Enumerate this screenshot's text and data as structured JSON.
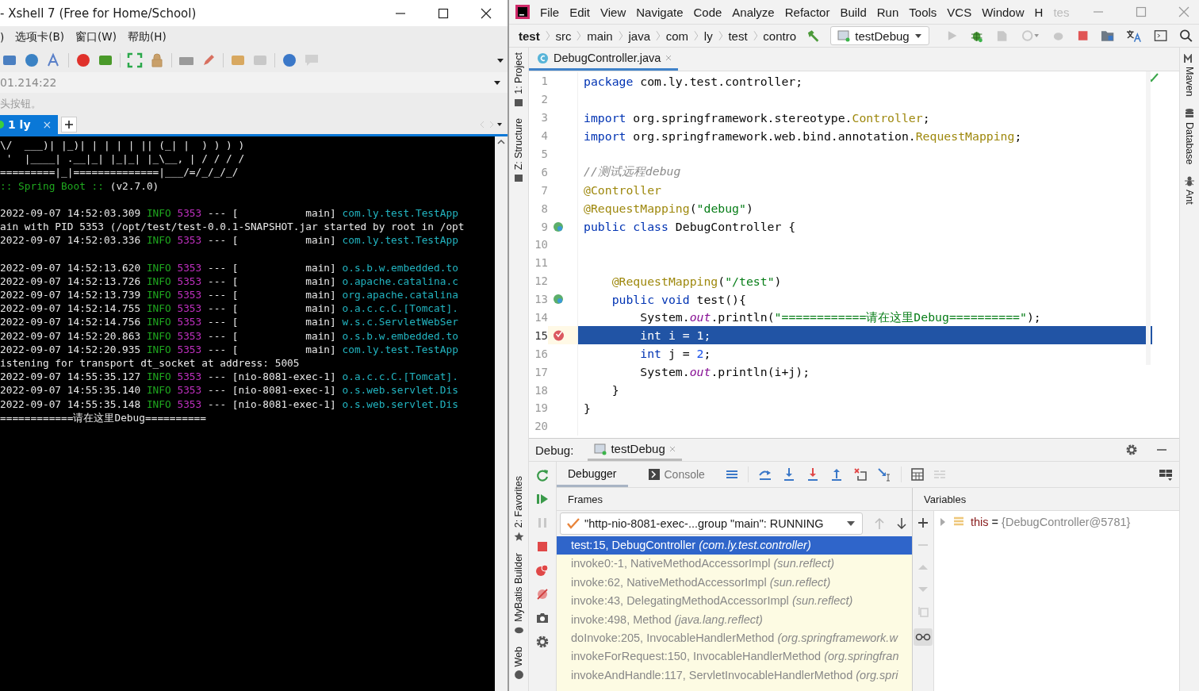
{
  "xshell": {
    "title": "- Xshell 7 (Free for Home/School)",
    "menu": [
      ")",
      "选项卡(B)",
      "窗口(W)",
      "帮助(H)"
    ],
    "address": "01.214:22",
    "hint": "头按钮。",
    "tabs": [
      {
        "label": "1 ly",
        "close": "×",
        "selected": true
      }
    ],
    "terminal": [
      {
        "kind": "art",
        "text": "\\/  ___)| |_)| | | | | || (_| |  ) ) ) )"
      },
      {
        "kind": "art",
        "text": " '  |____| .__|_| |_|_| |_\\__, | / / / /"
      },
      {
        "kind": "art",
        "text": "=========|_|==============|___/=/_/_/_/"
      },
      {
        "kind": "banner",
        "label": ":: Spring Boot ::",
        "version": "(v2.7.0)"
      },
      {
        "kind": "blank"
      },
      {
        "kind": "log",
        "time": "2022-09-07 14:52:03.309",
        "level": "INFO",
        "pid": "5353",
        "thread": "--- [           main]",
        "logger": "com.ly.test.TestApp"
      },
      {
        "kind": "text",
        "text": "ain with PID 5353 (/opt/test/test-0.0.1-SNAPSHOT.jar started by root in /opt"
      },
      {
        "kind": "log",
        "time": "2022-09-07 14:52:03.336",
        "level": "INFO",
        "pid": "5353",
        "thread": "--- [           main]",
        "logger": "com.ly.test.TestApp"
      },
      {
        "kind": "blank"
      },
      {
        "kind": "log",
        "time": "2022-09-07 14:52:13.620",
        "level": "INFO",
        "pid": "5353",
        "thread": "--- [           main]",
        "logger": "o.s.b.w.embedded.to"
      },
      {
        "kind": "log",
        "time": "2022-09-07 14:52:13.726",
        "level": "INFO",
        "pid": "5353",
        "thread": "--- [           main]",
        "logger": "o.apache.catalina.c"
      },
      {
        "kind": "log",
        "time": "2022-09-07 14:52:13.739",
        "level": "INFO",
        "pid": "5353",
        "thread": "--- [           main]",
        "logger": "org.apache.catalina"
      },
      {
        "kind": "log",
        "time": "2022-09-07 14:52:14.755",
        "level": "INFO",
        "pid": "5353",
        "thread": "--- [           main]",
        "logger": "o.a.c.c.C.[Tomcat]."
      },
      {
        "kind": "log",
        "time": "2022-09-07 14:52:14.756",
        "level": "INFO",
        "pid": "5353",
        "thread": "--- [           main]",
        "logger": "w.s.c.ServletWebSer"
      },
      {
        "kind": "log",
        "time": "2022-09-07 14:52:20.863",
        "level": "INFO",
        "pid": "5353",
        "thread": "--- [           main]",
        "logger": "o.s.b.w.embedded.to"
      },
      {
        "kind": "log",
        "time": "2022-09-07 14:52:20.935",
        "level": "INFO",
        "pid": "5353",
        "thread": "--- [           main]",
        "logger": "com.ly.test.TestApp"
      },
      {
        "kind": "text",
        "text": "istening for transport dt_socket at address: 5005"
      },
      {
        "kind": "log",
        "time": "2022-09-07 14:55:35.127",
        "level": "INFO",
        "pid": "5353",
        "thread": "--- [nio-8081-exec-1]",
        "logger": "o.a.c.c.C.[Tomcat]."
      },
      {
        "kind": "log",
        "time": "2022-09-07 14:55:35.140",
        "level": "INFO",
        "pid": "5353",
        "thread": "--- [nio-8081-exec-1]",
        "logger": "o.s.web.servlet.Dis"
      },
      {
        "kind": "log",
        "time": "2022-09-07 14:55:35.148",
        "level": "INFO",
        "pid": "5353",
        "thread": "--- [nio-8081-exec-1]",
        "logger": "o.s.web.servlet.Dis"
      },
      {
        "kind": "text",
        "text": "============请在这里Debug=========="
      }
    ]
  },
  "ide": {
    "menu": [
      "File",
      "Edit",
      "View",
      "Navigate",
      "Code",
      "Analyze",
      "Refactor",
      "Build",
      "Run",
      "Tools",
      "VCS",
      "Window",
      "H"
    ],
    "title": "tes",
    "breadcrumbs": [
      "test",
      "src",
      "main",
      "java",
      "com",
      "ly",
      "test",
      "contro"
    ],
    "run_config": "testDebug",
    "left_tools": [
      "1: Project",
      "Z: Structure"
    ],
    "bottom_tools": [
      "2: Favorites",
      "MyBatis Builder",
      "Web"
    ],
    "right_tools": [
      "Maven",
      "Database",
      "Ant"
    ],
    "editor_tab": "DebugController.java",
    "code": [
      {
        "number": "1",
        "selected": false,
        "tokens": [
          {
            "kind": "kw",
            "text": "package"
          },
          {
            "kind": "plain",
            "text": " com.ly.test.controller;"
          }
        ]
      },
      {
        "number": "2",
        "selected": false
      },
      {
        "number": "3",
        "selected": false,
        "tokens": [
          {
            "kind": "kw",
            "text": "import"
          },
          {
            "kind": "plain",
            "text": " org.springframework.stereotype."
          },
          {
            "kind": "ann",
            "text": "Controller"
          },
          {
            "kind": "plain",
            "text": ";"
          }
        ]
      },
      {
        "number": "4",
        "selected": false,
        "tokens": [
          {
            "kind": "kw",
            "text": "import"
          },
          {
            "kind": "plain",
            "text": " org.springframework.web.bind.annotation."
          },
          {
            "kind": "ann",
            "text": "RequestMapping"
          },
          {
            "kind": "plain",
            "text": ";"
          }
        ]
      },
      {
        "number": "5",
        "selected": false
      },
      {
        "number": "6",
        "selected": false,
        "tokens": [
          {
            "kind": "com",
            "text": "//测试远程debug"
          }
        ]
      },
      {
        "number": "7",
        "selected": false,
        "tokens": [
          {
            "kind": "ann",
            "text": "@Controller"
          }
        ]
      },
      {
        "number": "8",
        "selected": false,
        "tokens": [
          {
            "kind": "ann",
            "text": "@RequestMapping"
          },
          {
            "kind": "plain",
            "text": "("
          },
          {
            "kind": "str",
            "text": "\"debug\""
          },
          {
            "kind": "plain",
            "text": ")"
          }
        ]
      },
      {
        "number": "9",
        "selected": false,
        "kind": "bean",
        "tokens": [
          {
            "kind": "kw",
            "text": "public class"
          },
          {
            "kind": "plain",
            "text": " DebugController {"
          }
        ]
      },
      {
        "number": "10",
        "selected": false
      },
      {
        "number": "11",
        "selected": false
      },
      {
        "number": "12",
        "selected": false,
        "tokens": [
          {
            "kind": "ann",
            "text": "    @RequestMapping"
          },
          {
            "kind": "plain",
            "text": "("
          },
          {
            "kind": "str",
            "text": "\"/test\""
          },
          {
            "kind": "plain",
            "text": ")"
          }
        ]
      },
      {
        "number": "13",
        "selected": false,
        "kind": "bean",
        "tokens": [
          {
            "kind": "kw",
            "text": "    public void"
          },
          {
            "kind": "plain",
            "text": " test(){"
          }
        ]
      },
      {
        "number": "14",
        "selected": false,
        "tokens": [
          {
            "kind": "plain",
            "text": "        System."
          },
          {
            "kind": "field",
            "text": "out"
          },
          {
            "kind": "plain",
            "text": ".println("
          },
          {
            "kind": "str",
            "text": "\"============请在这里Debug==========\""
          },
          {
            "kind": "plain",
            "text": ");"
          }
        ]
      },
      {
        "number": "15",
        "selected": true,
        "kind": "breakpoint",
        "tokens": [
          {
            "kind": "kw",
            "text": "        int"
          },
          {
            "kind": "plain",
            "text": " i = "
          },
          {
            "kind": "num",
            "text": "1"
          },
          {
            "kind": "plain",
            "text": ";"
          }
        ]
      },
      {
        "number": "16",
        "selected": false,
        "tokens": [
          {
            "kind": "kw",
            "text": "        int"
          },
          {
            "kind": "plain",
            "text": " j = "
          },
          {
            "kind": "num",
            "text": "2"
          },
          {
            "kind": "plain",
            "text": ";"
          }
        ]
      },
      {
        "number": "17",
        "selected": false,
        "tokens": [
          {
            "kind": "plain",
            "text": "        System."
          },
          {
            "kind": "field",
            "text": "out"
          },
          {
            "kind": "plain",
            "text": ".println(i+j);"
          }
        ]
      },
      {
        "number": "18",
        "selected": false,
        "tokens": [
          {
            "kind": "plain",
            "text": "    }"
          }
        ]
      },
      {
        "number": "19",
        "selected": false,
        "tokens": [
          {
            "kind": "plain",
            "text": "}"
          }
        ]
      },
      {
        "number": "20",
        "selected": false
      }
    ],
    "debug": {
      "label": "Debug:",
      "session": "testDebug",
      "tabs": [
        {
          "label": "Debugger",
          "selected": true
        },
        {
          "label": "Console",
          "selected": false
        }
      ],
      "frames_title": "Frames",
      "thread": "\"http-nio-8081-exec-...group \"main\": RUNNING",
      "frames": [
        {
          "method": "test:15, DebugController",
          "package": "(com.ly.test.controller)",
          "selected": true
        },
        {
          "method": "invoke0:-1, NativeMethodAccessorImpl",
          "package": "(sun.reflect)",
          "selected": false
        },
        {
          "method": "invoke:62, NativeMethodAccessorImpl",
          "package": "(sun.reflect)",
          "selected": false
        },
        {
          "method": "invoke:43, DelegatingMethodAccessorImpl",
          "package": "(sun.reflect)",
          "selected": false
        },
        {
          "method": "invoke:498, Method",
          "package": "(java.lang.reflect)",
          "selected": false
        },
        {
          "method": "doInvoke:205, InvocableHandlerMethod",
          "package": "(org.springframework.w",
          "selected": false
        },
        {
          "method": "invokeForRequest:150, InvocableHandlerMethod",
          "package": "(org.springfran",
          "selected": false
        },
        {
          "method": "invokeAndHandle:117, ServletInvocableHandlerMethod",
          "package": "(org.spri",
          "selected": false
        }
      ],
      "variables_title": "Variables",
      "variables": [
        {
          "name": "this",
          "separator": "=",
          "value": "{DebugController@5781}"
        }
      ]
    }
  }
}
